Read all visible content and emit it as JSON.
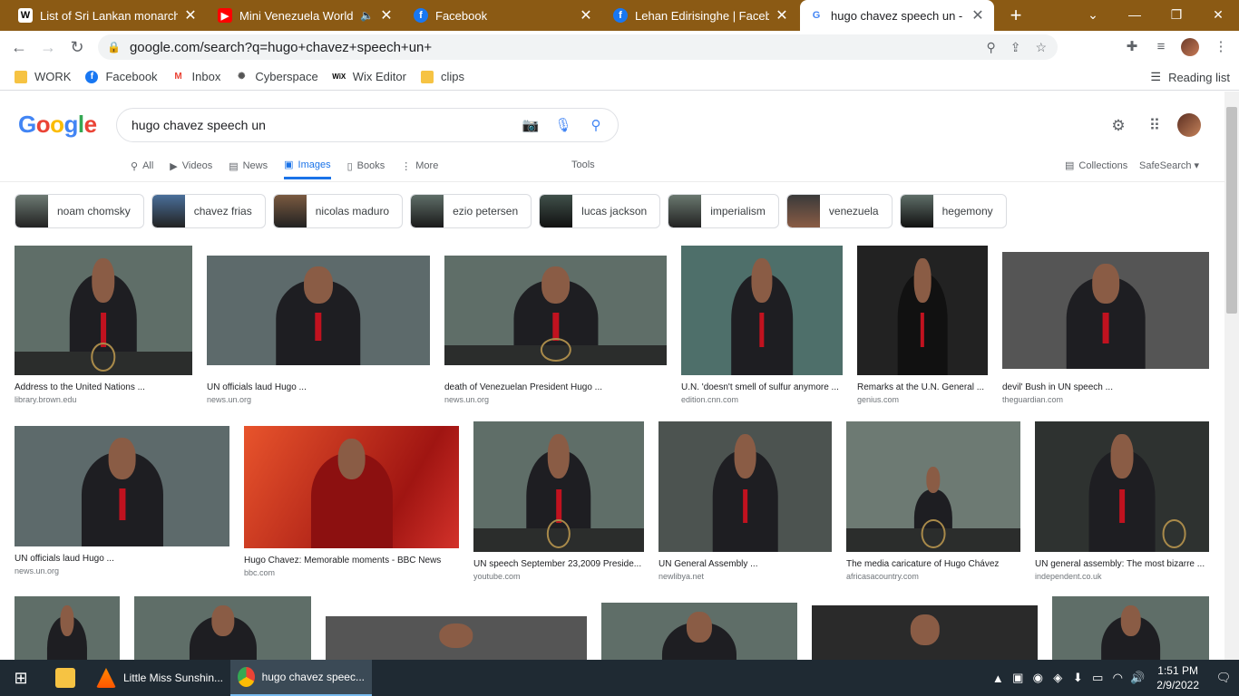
{
  "browser": {
    "tabs": [
      {
        "title": "List of Sri Lankan monarchs -",
        "favicon": "W",
        "color": "#ffffff"
      },
      {
        "title": "Mini Venezuela World S",
        "favicon": "▶",
        "color": "#ff0000"
      },
      {
        "title": "Facebook",
        "favicon": "f",
        "color": "#1877f2"
      },
      {
        "title": "Lehan Edirisinghe | Facebook",
        "favicon": "f",
        "color": "#1877f2"
      },
      {
        "title": "hugo chavez speech un - Go",
        "favicon": "G",
        "color": "#4285f4"
      }
    ],
    "url_host": "google.com",
    "url_path": "/search?q=hugo+chavez+speech+un+",
    "bookmarks": [
      "WORK",
      "Facebook",
      "Inbox",
      "Cyberspace",
      "Wix Editor",
      "clips"
    ],
    "reading_list": "Reading list"
  },
  "google": {
    "logo": [
      "G",
      "o",
      "o",
      "g",
      "l",
      "e"
    ],
    "query": "hugo chavez speech un",
    "tabs": [
      {
        "label": "All",
        "icon": "search-icon"
      },
      {
        "label": "Videos",
        "icon": "video-icon"
      },
      {
        "label": "News",
        "icon": "news-icon"
      },
      {
        "label": "Images",
        "icon": "image-icon"
      },
      {
        "label": "Books",
        "icon": "book-icon"
      },
      {
        "label": "More",
        "icon": "more-icon"
      }
    ],
    "tools": "Tools",
    "collections": "Collections",
    "safesearch": "SafeSearch ▾",
    "chips": [
      "noam chomsky",
      "chavez frias",
      "nicolas maduro",
      "ezio petersen",
      "lucas jackson",
      "imperialism",
      "venezuela",
      "hegemony"
    ]
  },
  "results": [
    {
      "caption": "Address to the United Nations ...",
      "source": "library.brown.edu"
    },
    {
      "caption": "UN officials laud Hugo ...",
      "source": "news.un.org"
    },
    {
      "caption": "death of Venezuelan President Hugo ...",
      "source": "news.un.org"
    },
    {
      "caption": "U.N. 'doesn't smell of sulfur anymore ...",
      "source": "edition.cnn.com"
    },
    {
      "caption": "Remarks at the U.N. General ...",
      "source": "genius.com"
    },
    {
      "caption": "devil' Bush in UN speech ...",
      "source": "theguardian.com"
    },
    {
      "caption": "UN officials laud Hugo ...",
      "source": "news.un.org"
    },
    {
      "caption": "Hugo Chavez: Memorable moments - BBC News",
      "source": "bbc.com"
    },
    {
      "caption": "UN speech September 23,2009 Preside...",
      "source": "youtube.com"
    },
    {
      "caption": "UN General Assembly ...",
      "source": "newlibya.net"
    },
    {
      "caption": "The media caricature of Hugo Chávez",
      "source": "africasacountry.com"
    },
    {
      "caption": "UN general assembly: The most bizarre ...",
      "source": "independent.co.uk"
    }
  ],
  "taskbar": {
    "apps": [
      "Little Miss Sunshin...",
      "hugo chavez speec..."
    ],
    "time": "1:51 PM",
    "date": "2/9/2022"
  }
}
